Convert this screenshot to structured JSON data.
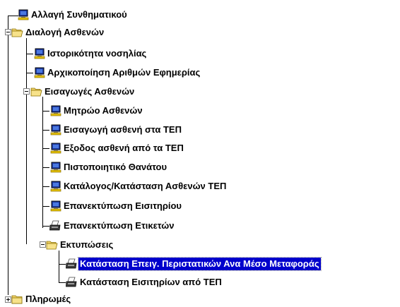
{
  "tree": {
    "items": [
      {
        "label": "Αλλαγή Συνθηματικού",
        "icon": "computer-icon"
      },
      {
        "label": "Διαλογή Ασθενών",
        "icon": "folder-open-icon",
        "expanded": true
      },
      {
        "label": "Ιστορικότητα νοσηλίας",
        "icon": "computer-icon"
      },
      {
        "label": "Αρχικοποίηση Αριθμών Εφημερίας",
        "icon": "computer-icon"
      },
      {
        "label": "Εισαγωγές Ασθενών",
        "icon": "folder-open-icon",
        "expanded": true
      },
      {
        "label": "Μητρώο Ασθενών",
        "icon": "computer-icon"
      },
      {
        "label": "Εισαγωγή ασθενή στα ΤΕΠ",
        "icon": "computer-icon"
      },
      {
        "label": "Εξοδος ασθενή από τα ΤΕΠ",
        "icon": "computer-icon"
      },
      {
        "label": "Πιστοποιητικό Θανάτου",
        "icon": "computer-icon"
      },
      {
        "label": "Κατάλογος/Κατάσταση Ασθενών ΤΕΠ",
        "icon": "computer-icon"
      },
      {
        "label": "Επανεκτύπωση Εισιτηρίου",
        "icon": "computer-icon"
      },
      {
        "label": "Επανεκτύπωση Ετικετών",
        "icon": "printer-icon"
      },
      {
        "label": "Εκτυπώσεις",
        "icon": "folder-open-icon",
        "expanded": true
      },
      {
        "label": "Κατάσταση Επειγ. Περιστατικών Ανα Μέσο Μεταφοράς",
        "icon": "printer-icon",
        "selected": true
      },
      {
        "label": "Κατάσταση Εισιτηρίων από ΤΕΠ",
        "icon": "printer-icon"
      },
      {
        "label": "Πληρωμές",
        "icon": "folder-closed-icon",
        "expanded": false
      }
    ]
  },
  "colors": {
    "selection": "#0000cc",
    "folder": "#f2d36b",
    "computer_screen": "#1e3ca8",
    "computer_base": "#e6c200"
  }
}
